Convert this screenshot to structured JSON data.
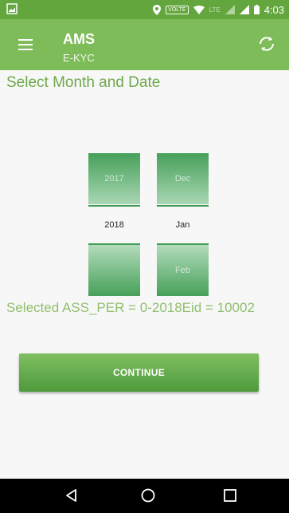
{
  "status_bar": {
    "time": "4:03",
    "volte": "VOLTE",
    "lte": "LTE",
    "icons": [
      "image-icon",
      "location-icon",
      "volte-badge",
      "wifi-icon",
      "lte-signal-icon",
      "signal-icon",
      "battery-icon"
    ]
  },
  "app_bar": {
    "title": "AMS",
    "subtitle": "E-KYC",
    "menu_icon": "hamburger-menu-icon",
    "refresh_icon": "refresh-icon"
  },
  "main": {
    "heading": "Select Month and Date",
    "year_picker": {
      "prev": "2017",
      "selected": "2018",
      "next": ""
    },
    "month_picker": {
      "prev": "Dec",
      "selected": "Jan",
      "next": "Feb"
    },
    "selected_text": "Selected ASS_PER = 0-2018Eid = 10002",
    "continue_label": "CONTINUE"
  },
  "nav_bar": {
    "icons": [
      "back-icon",
      "home-icon",
      "recent-apps-icon"
    ]
  },
  "colors": {
    "status_bar": "#63a63d",
    "app_bar": "#7ebc59",
    "accent_text": "#6ea84a",
    "picker_green": "#47a05a",
    "button": "#5fa847"
  }
}
